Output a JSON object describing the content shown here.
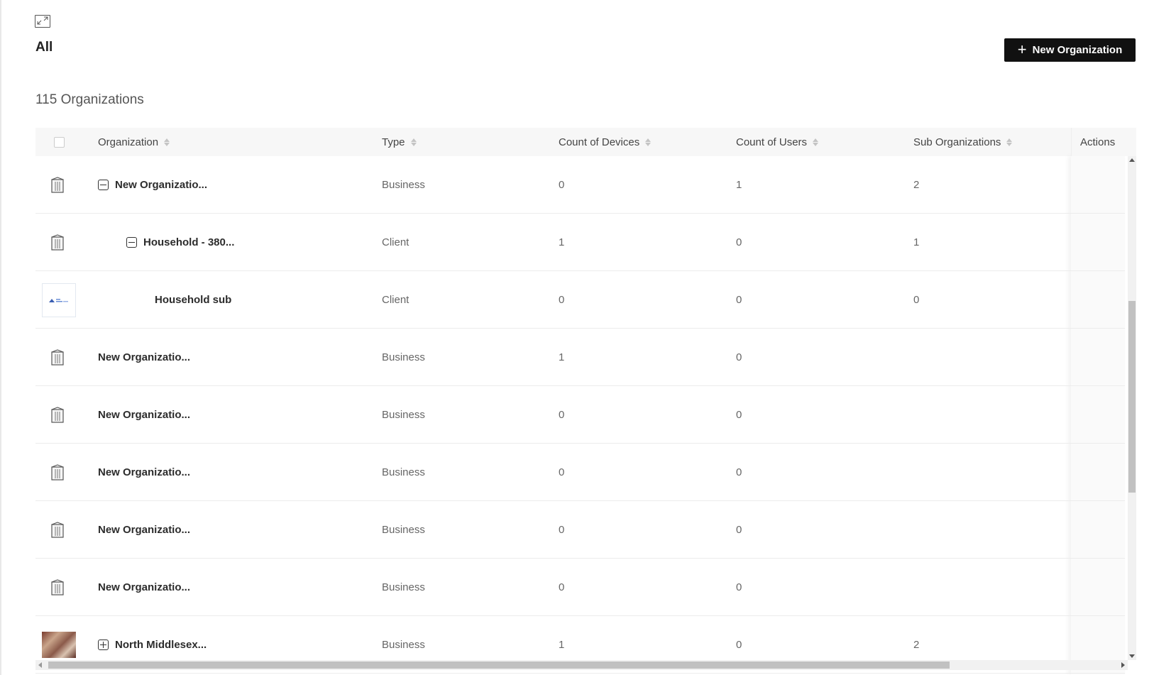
{
  "view": {
    "title": "All"
  },
  "header": {
    "new_button_label": "New Organization"
  },
  "summary": {
    "count_label": "115 Organizations"
  },
  "table": {
    "columns": {
      "organization": "Organization",
      "type": "Type",
      "devices": "Count of Devices",
      "users": "Count of Users",
      "sub_orgs": "Sub Organizations",
      "actions": "Actions"
    },
    "rows": [
      {
        "icon": "building-icon",
        "name": "New Organizatio...",
        "type": "Business",
        "devices": "0",
        "users": "1",
        "sub_orgs": "2"
      },
      {
        "icon": "building-icon",
        "name": "Household - 380...",
        "type": "Client",
        "devices": "1",
        "users": "0",
        "sub_orgs": "1"
      },
      {
        "icon": "logo-thumbnail",
        "name": "Household sub",
        "type": "Client",
        "devices": "0",
        "users": "0",
        "sub_orgs": "0"
      },
      {
        "icon": "building-icon",
        "name": "New Organizatio...",
        "type": "Business",
        "devices": "1",
        "users": "0",
        "sub_orgs": ""
      },
      {
        "icon": "building-icon",
        "name": "New Organizatio...",
        "type": "Business",
        "devices": "0",
        "users": "0",
        "sub_orgs": ""
      },
      {
        "icon": "building-icon",
        "name": "New Organizatio...",
        "type": "Business",
        "devices": "0",
        "users": "0",
        "sub_orgs": ""
      },
      {
        "icon": "building-icon",
        "name": "New Organizatio...",
        "type": "Business",
        "devices": "0",
        "users": "0",
        "sub_orgs": ""
      },
      {
        "icon": "building-icon",
        "name": "New Organizatio...",
        "type": "Business",
        "devices": "0",
        "users": "0",
        "sub_orgs": ""
      },
      {
        "icon": "photo-thumbnail",
        "name": "North Middlesex...",
        "type": "Business",
        "devices": "1",
        "users": "0",
        "sub_orgs": "2"
      }
    ]
  }
}
